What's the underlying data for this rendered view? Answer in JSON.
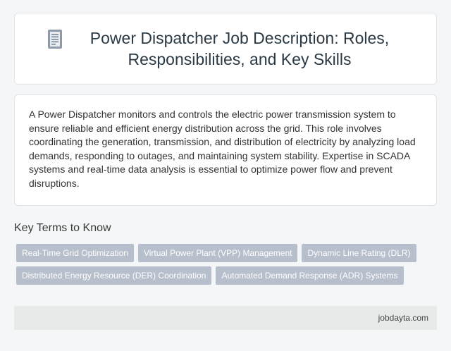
{
  "header": {
    "icon": "document-icon",
    "title": "Power Dispatcher Job Description: Roles, Responsibilities, and Key Skills"
  },
  "description": {
    "text": "A Power Dispatcher monitors and controls the electric power transmission system to ensure reliable and efficient energy distribution across the grid. This role involves coordinating the generation, transmission, and distribution of electricity by analyzing load demands, responding to outages, and maintaining system stability. Expertise in SCADA systems and real-time data analysis is essential to optimize power flow and prevent disruptions."
  },
  "key_terms": {
    "heading": "Key Terms to Know",
    "items": [
      {
        "label": "Real-Time Grid Optimization"
      },
      {
        "label": "Virtual Power Plant (VPP) Management"
      },
      {
        "label": "Dynamic Line Rating (DLR)"
      },
      {
        "label": "Distributed Energy Resource (DER) Coordination"
      },
      {
        "label": "Automated Demand Response (ADR) Systems"
      }
    ]
  },
  "footer": {
    "site": "jobdayta.com"
  },
  "colors": {
    "tag_background": "#b7bfcc",
    "footer_background": "#e6ebea",
    "page_background": "#f4f6f7"
  }
}
